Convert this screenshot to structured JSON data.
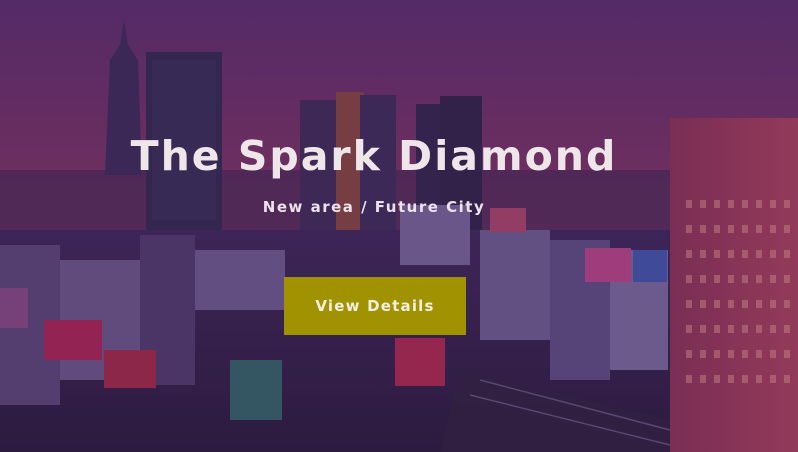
{
  "hero": {
    "title": "The Spark Diamond",
    "subtitle": "New area / Future City",
    "cta_label": "View Details"
  },
  "colors": {
    "cta_background": "#a09200",
    "text": "#efe6ea",
    "overlay": "#5b2f6a"
  }
}
